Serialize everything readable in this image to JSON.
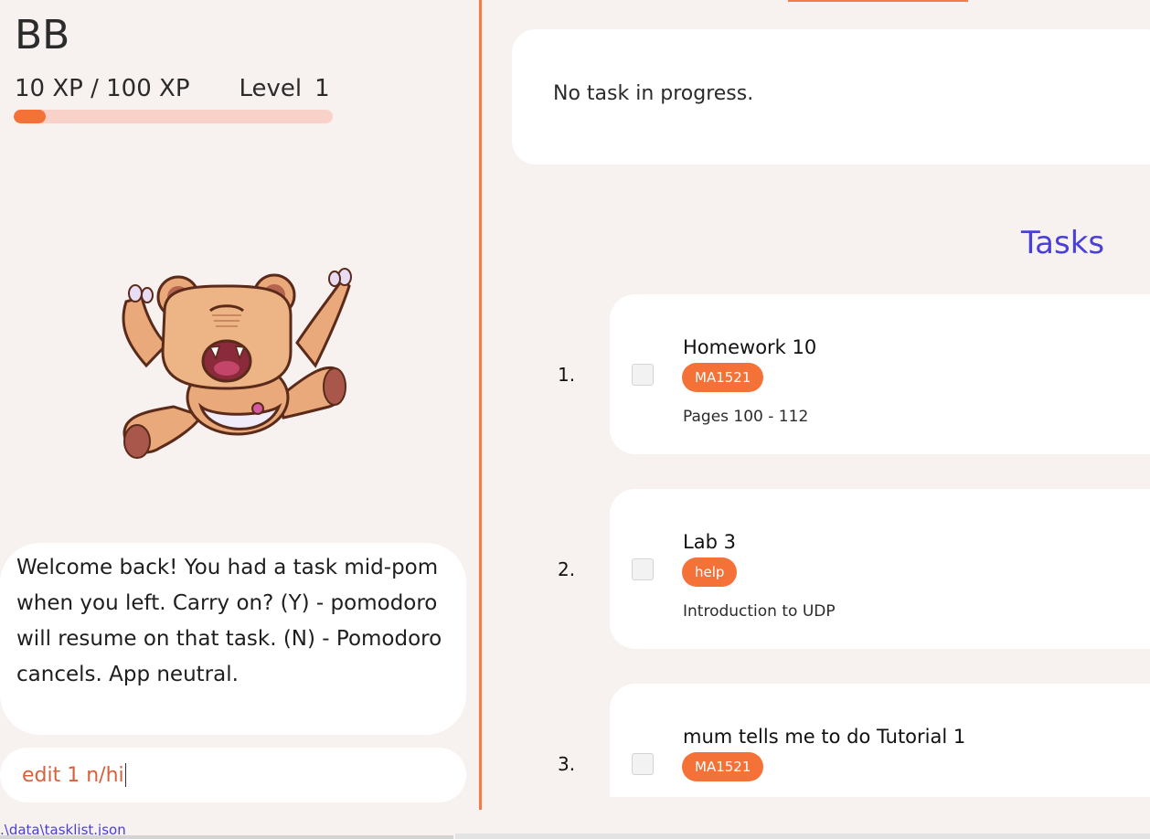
{
  "pet": {
    "name": "BB",
    "xp_text": "10 XP / 100 XP",
    "level_label": "Level",
    "level_value": "1",
    "xp_progress": 0.1
  },
  "speech": {
    "text": "Welcome back! You had a task mid-pom when you left. Carry on? (Y) - pomodoro will resume on that task. (N) - Pomodoro cancels. App neutral."
  },
  "command": {
    "value": "edit 1 n/hi"
  },
  "status": {
    "file_path": ".\\data\\tasklist.json"
  },
  "in_progress": {
    "message": "No task in progress."
  },
  "tasks_title": "Tasks",
  "tasks": [
    {
      "index": "1.",
      "name": "Homework 10",
      "tag": "MA1521",
      "desc": "Pages 100 - 112"
    },
    {
      "index": "2.",
      "name": "Lab 3",
      "tag": "help",
      "desc": "Introduction to UDP"
    },
    {
      "index": "3.",
      "name": "mum tells me to do Tutorial 1",
      "tag": "MA1521",
      "desc": ""
    }
  ],
  "colors": {
    "accent": "#f47137",
    "title_blue": "#4a3fd8",
    "background": "#f7f1ef"
  }
}
